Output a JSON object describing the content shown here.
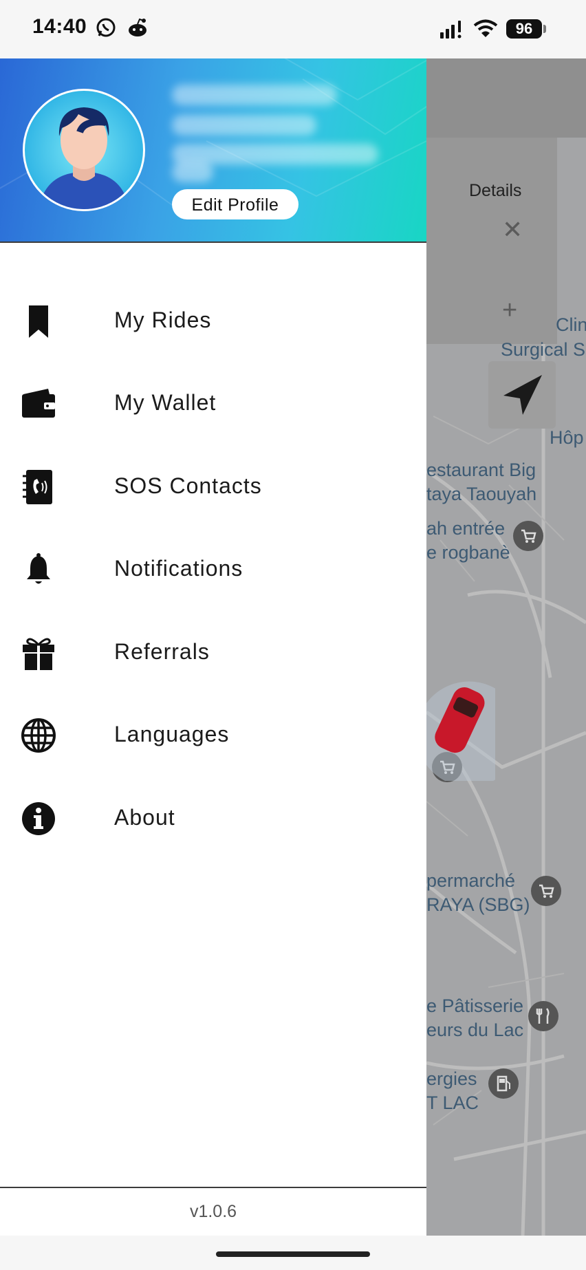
{
  "status_bar": {
    "time": "14:40",
    "battery": "96",
    "icons": [
      "whatsapp-icon",
      "reddit-icon",
      "signal-icon",
      "wifi-icon",
      "battery-icon"
    ]
  },
  "drawer": {
    "edit_profile_label": "Edit Profile",
    "menu": [
      {
        "label": "My Rides",
        "icon": "bookmark-icon"
      },
      {
        "label": "My Wallet",
        "icon": "wallet-icon"
      },
      {
        "label": "SOS Contacts",
        "icon": "phone-book-icon"
      },
      {
        "label": "Notifications",
        "icon": "bell-icon"
      },
      {
        "label": "Referrals",
        "icon": "gift-icon"
      },
      {
        "label": "Languages",
        "icon": "globe-icon"
      },
      {
        "label": "About",
        "icon": "info-icon"
      }
    ],
    "version": "v1.0.6"
  },
  "map": {
    "details_label": "Details",
    "labels": [
      "Clin",
      "Surgical S",
      "Hôp",
      "estaurant Big",
      "taya Taouyah",
      "ah entrée",
      "e rogbanè",
      "permarché",
      "RAYA (SBG)",
      "e Pâtisserie",
      "eurs du Lac",
      "ergies",
      "T LAC"
    ]
  },
  "colors": {
    "header_gradient_start": "#2a68d6",
    "header_gradient_end": "#18d6c4",
    "map_overlay": "#a4a5a7",
    "car": "#c8182a"
  }
}
